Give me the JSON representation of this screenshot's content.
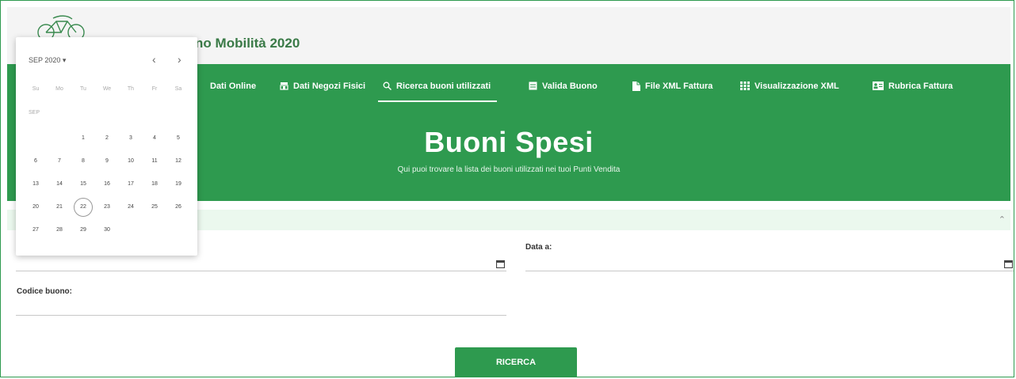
{
  "header": {
    "app_title": "Buono Mobilità 2020"
  },
  "nav": {
    "items": [
      {
        "label": "Dati Online",
        "icon": "monitor-icon"
      },
      {
        "label": "Dati Negozi Fisici",
        "icon": "store-icon"
      },
      {
        "label": "Ricerca buoni utilizzati",
        "icon": "search-icon",
        "active": true
      },
      {
        "label": "Valida Buono",
        "icon": "list-icon"
      },
      {
        "label": "File XML Fattura",
        "icon": "file-icon"
      },
      {
        "label": "Visualizzazione XML",
        "icon": "grid-icon"
      },
      {
        "label": "Rubrica Fattura",
        "icon": "contact-card-icon"
      }
    ]
  },
  "hero": {
    "title": "Buoni Spesi",
    "subtitle": "Qui puoi trovare la lista dei buoni utilizzati nei tuoi Punti Vendita"
  },
  "form": {
    "data_a_label": "Data a:",
    "codice_label": "Codice buono:",
    "data_da_value": "",
    "data_a_value": "",
    "codice_value": "",
    "submit_label": "RICERCA"
  },
  "datepicker": {
    "period_label": "SEP 2020",
    "month_label": "SEP",
    "weekdays": [
      "Su",
      "Mo",
      "Tu",
      "We",
      "Th",
      "Fr",
      "Sa"
    ],
    "first_weekday_index": 2,
    "days_in_month": 30,
    "selected_day": 22
  },
  "colors": {
    "primary_green": "#2e9a4f",
    "strip_green": "#ebf8ee"
  }
}
